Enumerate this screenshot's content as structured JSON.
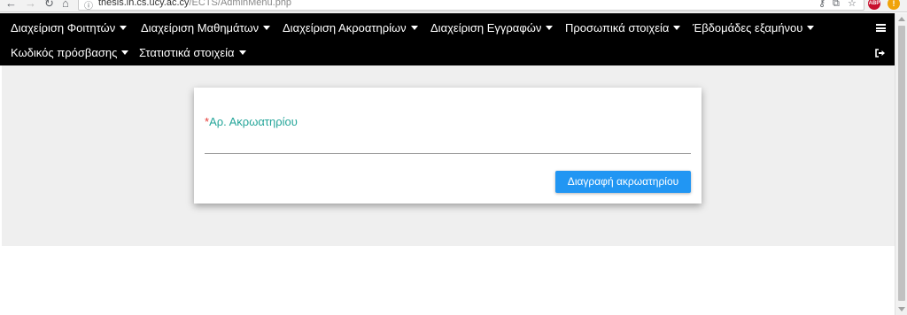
{
  "browser": {
    "back_icon": "back-arrow-icon",
    "forward_icon": "forward-arrow-icon",
    "reload_icon": "reload-icon",
    "home_icon": "home-icon",
    "url_host": "thesis.in.cs.ucy.ac.cy",
    "url_path": "/ECTS/AdminMenu.php",
    "abp_label": "ABP",
    "alert_label": "!"
  },
  "navbar": {
    "row1": [
      {
        "label": "Διαχείριση Φοιτητών"
      },
      {
        "label": "Διαχείριση Μαθημάτων"
      },
      {
        "label": "Διαχείριση Ακροατηρίων"
      },
      {
        "label": "Διαχείριση Εγγραφών"
      },
      {
        "label": "Προσωπικά στοιχεία"
      },
      {
        "label": "Έβδομάδες εξαμήνου"
      }
    ],
    "row2": [
      {
        "label": "Κωδικός πρόσβασης"
      },
      {
        "label": "Στατιστικά στοιχεία"
      }
    ],
    "menu_icon": "hamburger-menu-icon",
    "logout_icon": "logout-icon"
  },
  "form": {
    "required_marker": "*",
    "field_label": "Αρ. Ακρωατηρίου",
    "field_value": "",
    "submit_label": "Διαγραφή ακρωατηρίου"
  },
  "colors": {
    "navbar_bg": "#000000",
    "label_color": "#26a69a",
    "required_color": "#e53935",
    "button_bg": "#2196f3",
    "page_bg": "#efefef"
  }
}
